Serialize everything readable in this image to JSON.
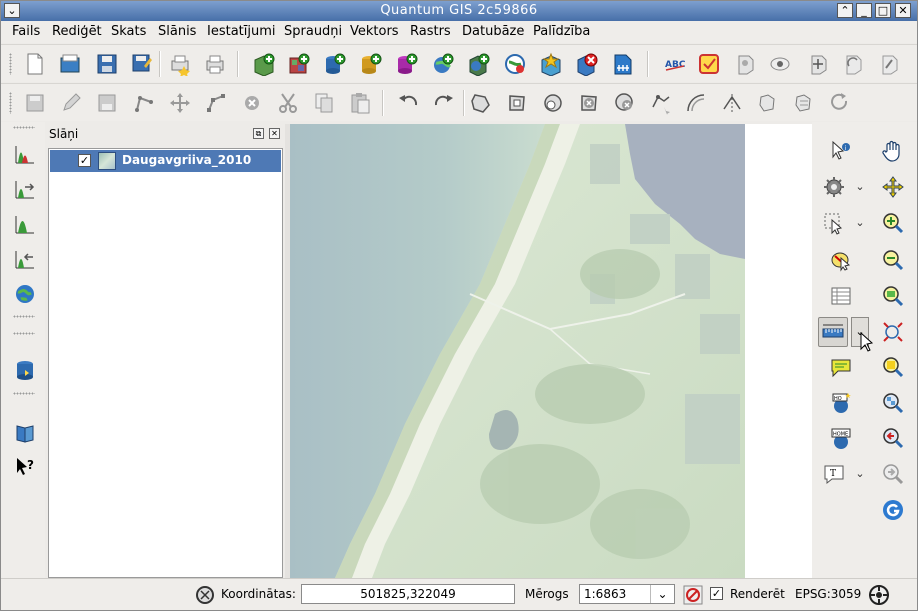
{
  "window": {
    "title": "Quantum GIS 2c59866"
  },
  "menu": [
    "Fails",
    "Rediģēt",
    "Skats",
    "Slānis",
    "Iestatījumi",
    "Spraudņi",
    "Vektors",
    "Rastrs",
    "Datubāze",
    "Palīdzība"
  ],
  "layers_panel": {
    "title": "Slāņi",
    "items": [
      {
        "name": "Daugavgriiva_2010",
        "checked": true
      }
    ]
  },
  "status": {
    "coord_label": "Koordinātas:",
    "coord_value": "501825,322049",
    "scale_label": "Mērogs",
    "scale_value": "1:6863",
    "render_label": "Renderēt",
    "render_checked": true,
    "crs": "EPSG:3059"
  },
  "colors": {
    "titlebar": "#5a80b8",
    "selection": "#4e79b5"
  }
}
